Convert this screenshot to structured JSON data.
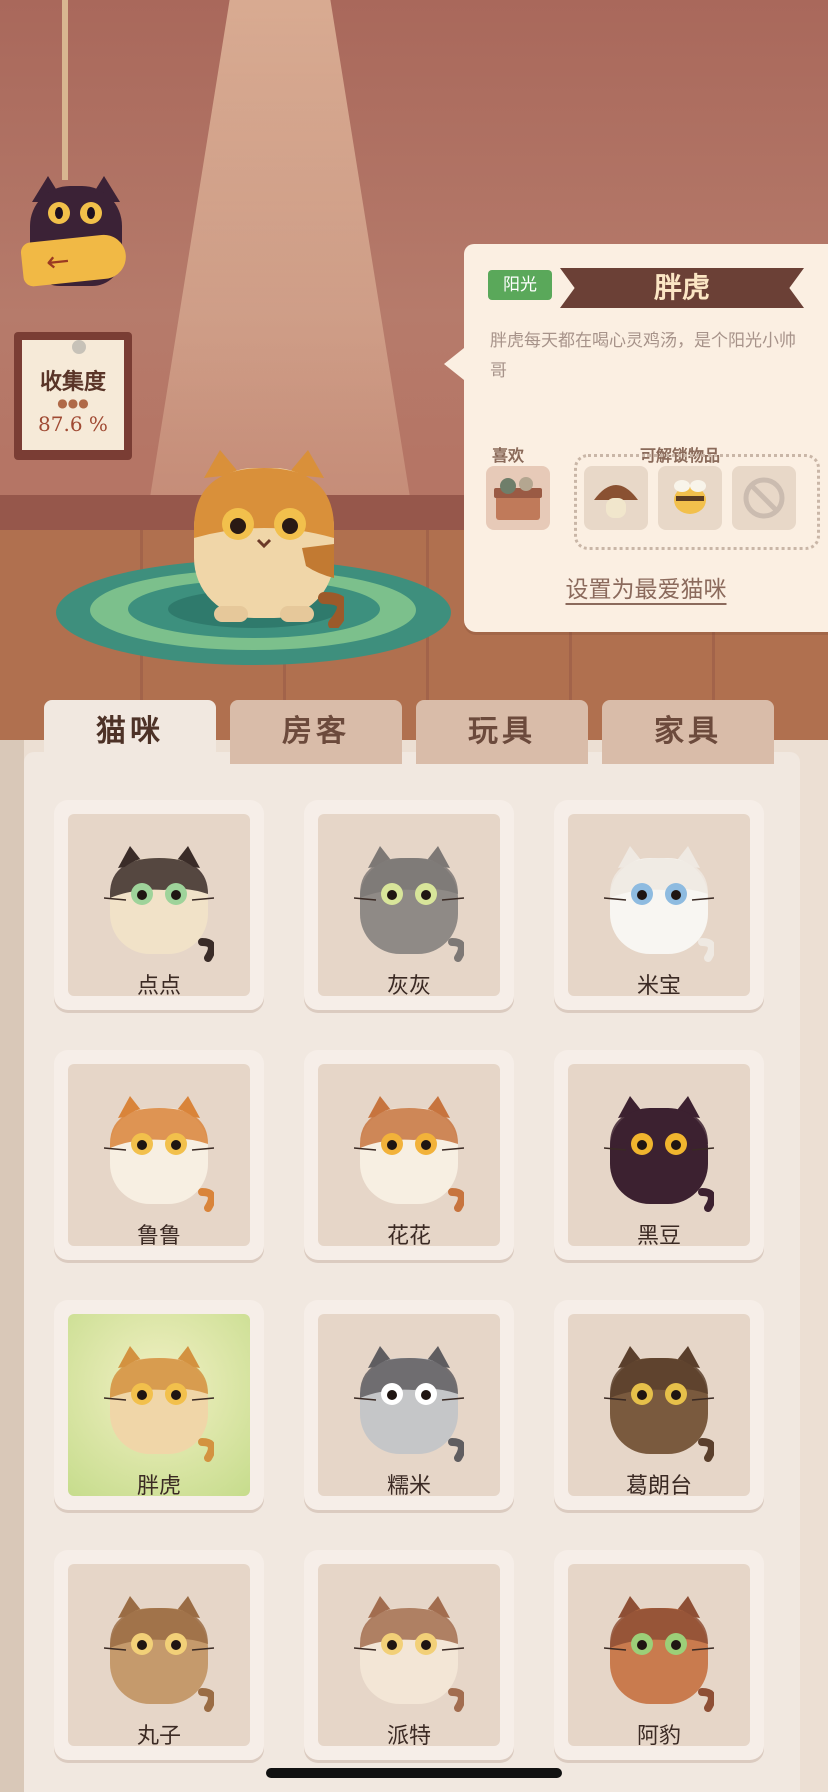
{
  "collection": {
    "title": "收集度",
    "value": "87.6 %"
  },
  "selected_cat": {
    "tag": "阳光",
    "name": "胖虎",
    "description": "胖虎每天都在喝心灵鸡汤，是个阳光小帅哥",
    "like_label": "喜欢",
    "unlock_label": "可解锁物品",
    "set_favorite": "设置为最爱猫咪"
  },
  "tabs": [
    {
      "label": "猫咪"
    },
    {
      "label": "房客"
    },
    {
      "label": "玩具"
    },
    {
      "label": "家具"
    }
  ],
  "cats": [
    {
      "name": "点点",
      "body": "#f1e2c8",
      "accent": "#3a2c28",
      "eye": "#9ed39a"
    },
    {
      "name": "灰灰",
      "body": "#8f8a86",
      "accent": "#7d7875",
      "eye": "#d8e59a"
    },
    {
      "name": "米宝",
      "body": "#f8f6f2",
      "accent": "#efe9e2",
      "eye": "#8ebbe0"
    },
    {
      "name": "鲁鲁",
      "body": "#f7efe2",
      "accent": "#d9843a",
      "eye": "#f2c04c"
    },
    {
      "name": "花花",
      "body": "#f7efe2",
      "accent": "#c7743e",
      "eye": "#f2b23a"
    },
    {
      "name": "黑豆",
      "body": "#3c2130",
      "accent": "#3c2130",
      "eye": "#f0b52e"
    },
    {
      "name": "胖虎",
      "body": "#f0d6a8",
      "accent": "#d39240",
      "eye": "#f2c04c"
    },
    {
      "name": "糯米",
      "body": "#c5c6c8",
      "accent": "#5f5d60",
      "eye": "#ffffff"
    },
    {
      "name": "葛朗台",
      "body": "#7a5a3e",
      "accent": "#5a3f2c",
      "eye": "#e6c04a"
    },
    {
      "name": "丸子",
      "body": "#c59a6c",
      "accent": "#9a6c44",
      "eye": "#f2d078"
    },
    {
      "name": "派特",
      "body": "#f3e6d6",
      "accent": "#a26d4f",
      "eye": "#f2d078"
    },
    {
      "name": "阿豹",
      "body": "#c97b4e",
      "accent": "#8e4f35",
      "eye": "#9ccf78"
    }
  ]
}
